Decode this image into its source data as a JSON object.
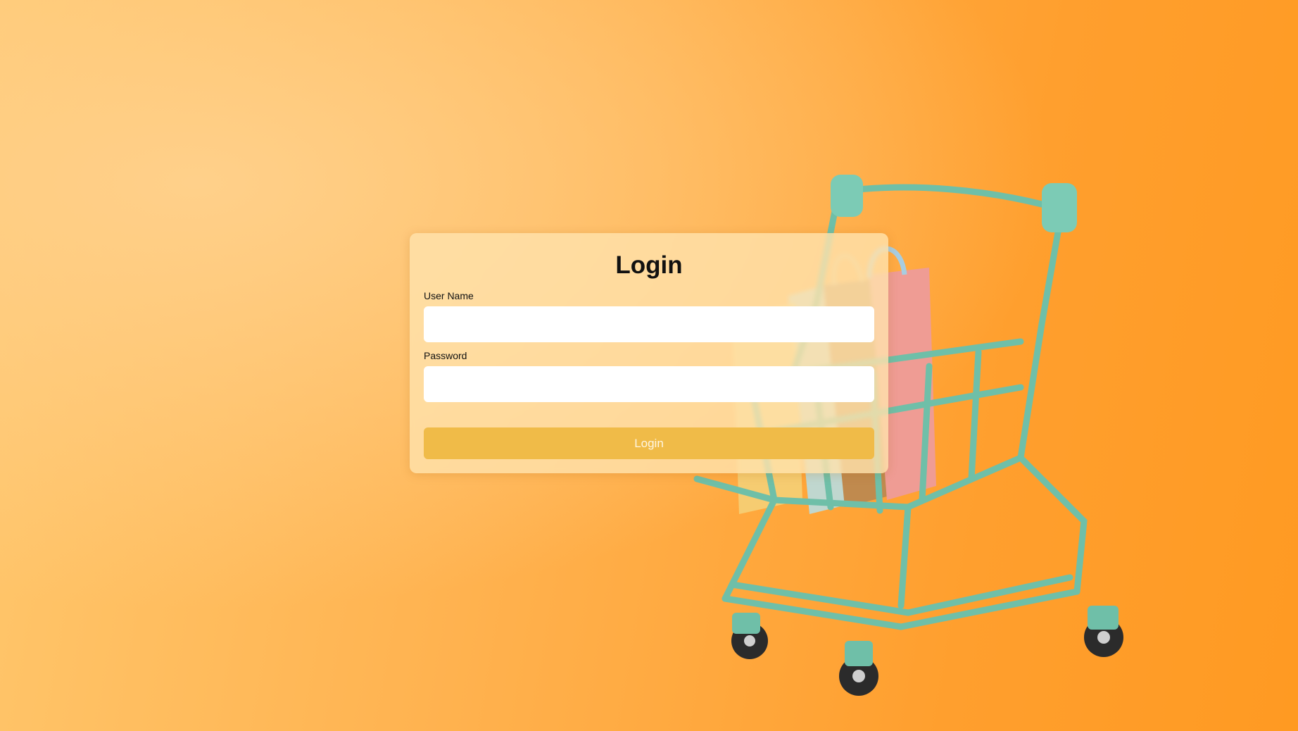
{
  "login_form": {
    "title": "Login",
    "username_label": "User Name",
    "username_value": "",
    "password_label": "Password",
    "password_value": "",
    "submit_label": "Login"
  },
  "background": {
    "image_subject": "shopping-cart-with-bags",
    "gradient_colors": [
      "#ffc86e",
      "#ff9a22"
    ],
    "cart_color": "#6fbfa8"
  },
  "theme": {
    "accent": "#f0bb48",
    "card_tint": "#ffe2ac"
  }
}
